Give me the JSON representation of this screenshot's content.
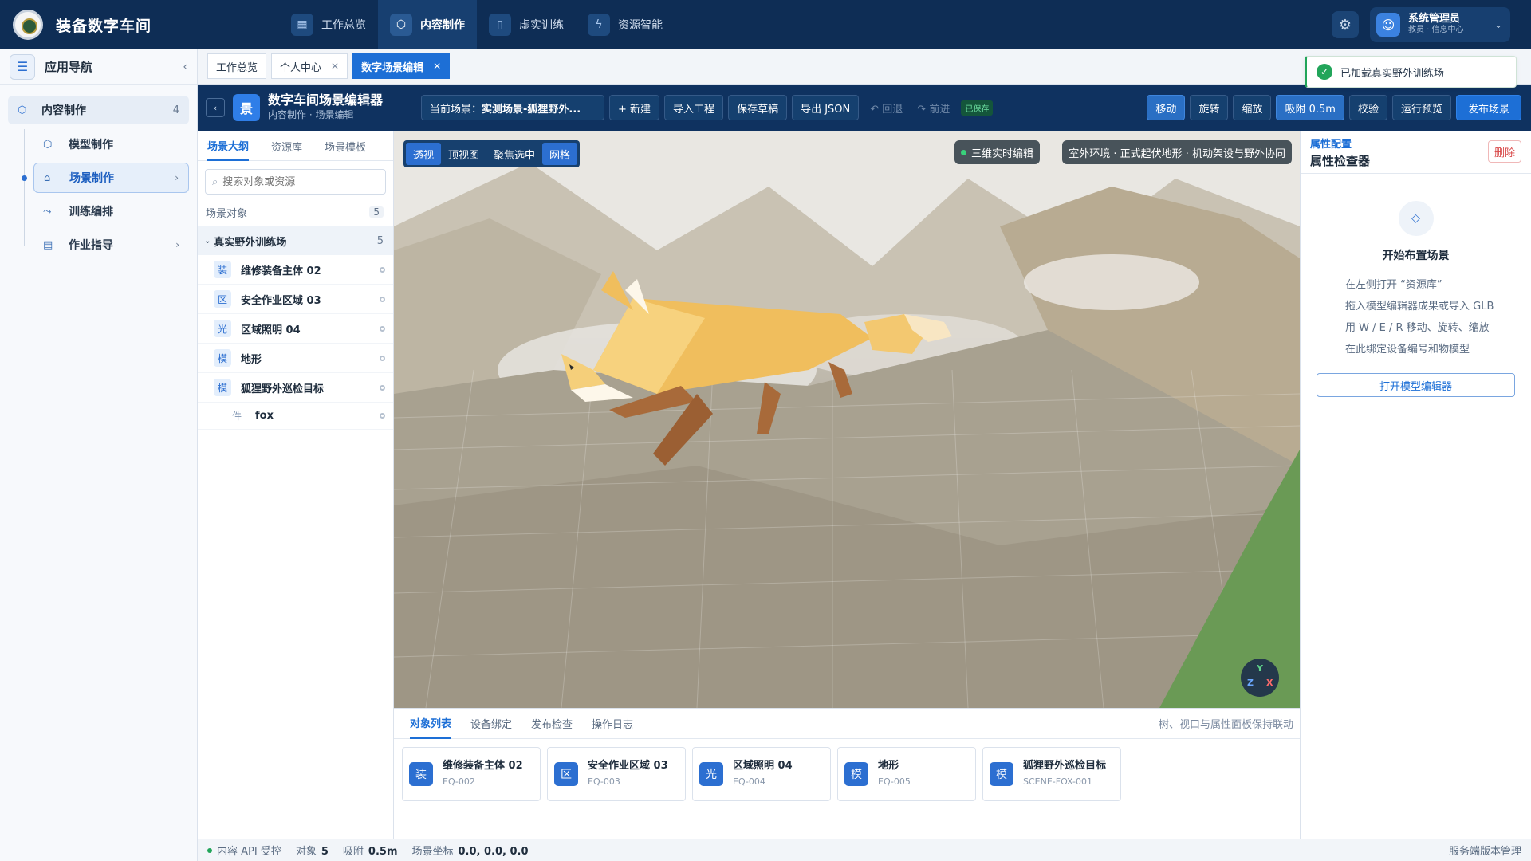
{
  "app": {
    "title": "装备数字车间"
  },
  "topnav": [
    {
      "label": "工作总览",
      "icon": "dashboard-icon"
    },
    {
      "label": "内容制作",
      "icon": "cube-icon",
      "active": true
    },
    {
      "label": "虚实训练",
      "icon": "book-icon"
    },
    {
      "label": "资源智能",
      "icon": "ai-icon"
    }
  ],
  "user": {
    "name": "系统管理员",
    "role": "教员 · 信息中心"
  },
  "sidebar": {
    "title": "应用导航",
    "group": {
      "label": "内容制作",
      "count": "4"
    },
    "items": [
      {
        "label": "模型制作",
        "icon": "cube-icon"
      },
      {
        "label": "场景制作",
        "icon": "scene-icon",
        "active": true
      },
      {
        "label": "训练编排",
        "icon": "flow-icon"
      },
      {
        "label": "作业指导",
        "icon": "doc-icon"
      }
    ]
  },
  "tabs": [
    {
      "label": "工作总览"
    },
    {
      "label": "个人中心",
      "closable": true
    },
    {
      "label": "数字场景编辑",
      "closable": true,
      "active": true
    }
  ],
  "toast": {
    "text": "已加载真实野外训练场"
  },
  "editor": {
    "logo": "景",
    "title": "数字车间场景编辑器",
    "subtitle": "内容制作 · 场景编辑",
    "scene_label": "当前场景：",
    "scene_value": "实测场景-狐狸野外...",
    "buttons": {
      "new": "+ 新建",
      "import": "导入工程",
      "save": "保存草稿",
      "export": "导出 JSON"
    },
    "undo": "↶ 回退",
    "redo": "↷ 前进",
    "saved": "已保存",
    "tools": {
      "move": "移动",
      "rotate": "旋转",
      "scale": "缩放",
      "snap": "吸附 0.5m",
      "validate": "校验",
      "preview": "运行预览",
      "publish": "发布场景"
    }
  },
  "outline": {
    "tabs": [
      "场景大纲",
      "资源库",
      "场景模板"
    ],
    "search_placeholder": "搜索对象或资源",
    "section_label": "场景对象",
    "section_count": "5",
    "group": {
      "label": "真实野外训练场",
      "count": "5"
    },
    "items": [
      {
        "badge": "装",
        "label": "维修装备主体 02"
      },
      {
        "badge": "区",
        "label": "安全作业区域 03"
      },
      {
        "badge": "光",
        "label": "区域照明 04"
      },
      {
        "badge": "模",
        "label": "地形"
      },
      {
        "badge": "模",
        "label": "狐狸野外巡检目标"
      }
    ],
    "child": {
      "badge": "件",
      "label": "fox"
    }
  },
  "viewport": {
    "views": [
      "透视",
      "顶视图",
      "聚焦选中",
      "网格"
    ],
    "chip_live": "三维实时编辑",
    "chip_env": "室外环境 · 正式起伏地形 · 机动架设与野外协同",
    "gizmo": {
      "y": "Y",
      "z": "Z",
      "x": "X"
    }
  },
  "bottom": {
    "tabs": [
      "对象列表",
      "设备绑定",
      "发布检查",
      "操作日志"
    ],
    "hint": "树、视口与属性面板保持联动",
    "cards": [
      {
        "badge": "装",
        "name": "维修装备主体 02",
        "code": "EQ-002"
      },
      {
        "badge": "区",
        "name": "安全作业区域 03",
        "code": "EQ-003"
      },
      {
        "badge": "光",
        "name": "区域照明 04",
        "code": "EQ-004"
      },
      {
        "badge": "模",
        "name": "地形",
        "code": "EQ-005"
      },
      {
        "badge": "模",
        "name": "狐狸野外巡检目标",
        "code": "SCENE-FOX-001"
      }
    ]
  },
  "inspector": {
    "kicker": "属性配置",
    "title": "属性检查器",
    "delete": "删除",
    "empty_title": "开始布置场景",
    "lines": [
      "在左侧打开 “资源库”",
      "拖入模型编辑器成果或导入 GLB",
      "用 W / E / R 移动、旋转、缩放",
      "在此绑定设备编号和物模型"
    ],
    "open_button": "打开模型编辑器"
  },
  "status": {
    "api": "内容 API 受控",
    "objects_label": "对象",
    "objects_value": "5",
    "snap_label": "吸附",
    "snap_value": "0.5m",
    "coord_label": "场景坐标",
    "coord_value": "0.0, 0.0, 0.0",
    "right": "服务端版本管理"
  }
}
